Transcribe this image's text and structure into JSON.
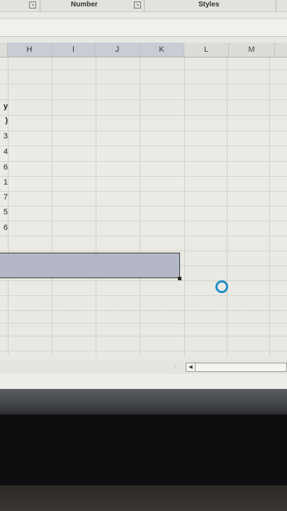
{
  "ribbon": {
    "groups": [
      {
        "label": "Number"
      },
      {
        "label": "Styles"
      }
    ]
  },
  "columns": [
    "H",
    "I",
    "J",
    "K",
    "L",
    "M"
  ],
  "selected_columns": [
    "H",
    "I",
    "J",
    "K"
  ],
  "partial_column_values": [
    "y",
    ")",
    "3",
    "4",
    "6",
    "1",
    "7",
    "5",
    "6"
  ]
}
